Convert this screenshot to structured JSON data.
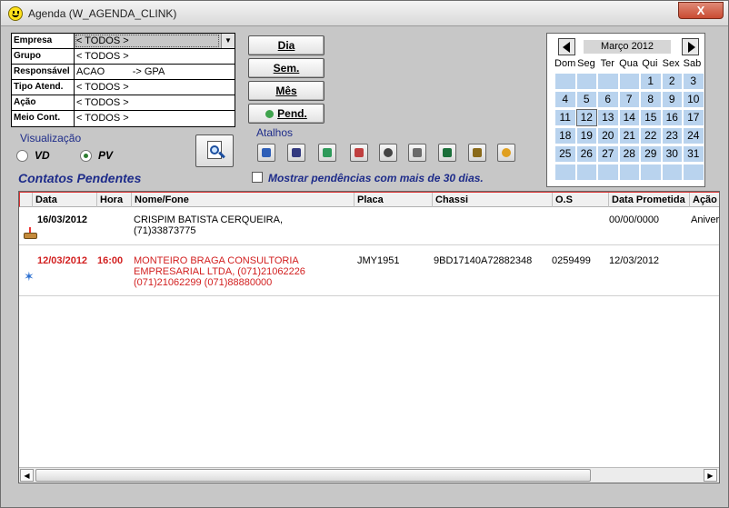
{
  "window": {
    "title": "Agenda (W_AGENDA_CLINK)",
    "close_label": "X"
  },
  "filters": [
    {
      "label": "Empresa",
      "value": "< TODOS >"
    },
    {
      "label": "Grupo",
      "value": "< TODOS >"
    },
    {
      "label": "Responsável",
      "value": "ACAO          -> GPA"
    },
    {
      "label": "Tipo Atend.",
      "value": "< TODOS >"
    },
    {
      "label": "Ação",
      "value": "< TODOS >"
    },
    {
      "label": "Meio Cont.",
      "value": "< TODOS >"
    }
  ],
  "view_buttons": {
    "dia": "Dia",
    "sem": "Sem.",
    "mes": "Mês",
    "pend": "Pend."
  },
  "visualizacao": {
    "label": "Visualização",
    "options": [
      "VD",
      "PV"
    ],
    "selected": "PV"
  },
  "atalhos": {
    "label": "Atalhos",
    "icons": [
      "car-icon",
      "runner-icon",
      "globe-icon",
      "card-icon",
      "wheel-icon",
      "checklist-icon",
      "spreadsheet-icon",
      "chip-icon",
      "coins-icon"
    ]
  },
  "section_title": "Contatos Pendentes",
  "pendencias_check": {
    "label": "Mostrar pendências com mais de 30 dias.",
    "checked": false
  },
  "calendar": {
    "month_label": "Março 2012",
    "weekdays": [
      "Dom",
      "Seg",
      "Ter",
      "Qua",
      "Qui",
      "Sex",
      "Sab"
    ],
    "cells": [
      "",
      "",
      "",
      "",
      "1",
      "2",
      "3",
      "4",
      "5",
      "6",
      "7",
      "8",
      "9",
      "10",
      "11",
      "12",
      "13",
      "14",
      "15",
      "16",
      "17",
      "18",
      "19",
      "20",
      "21",
      "22",
      "23",
      "24",
      "25",
      "26",
      "27",
      "28",
      "29",
      "30",
      "31",
      "",
      "",
      "",
      "",
      "",
      "",
      ""
    ],
    "selected_day": "12"
  },
  "grid": {
    "columns": [
      "Data",
      "Hora",
      "Nome/Fone",
      "Placa",
      "Chassi",
      "O.S",
      "Data Prometida",
      "Ação C"
    ],
    "rows": [
      {
        "icon": "cake-icon",
        "highlight": false,
        "data": "16/03/2012",
        "hora": "",
        "nome_lines": [
          "CRISPIM BATISTA CERQUEIRA,",
          "(71)33873775"
        ],
        "placa": "",
        "chassi": "",
        "os": "",
        "data_prometida": "00/00/0000",
        "acao": "Aniver"
      },
      {
        "icon": "fireworks-icon",
        "highlight": true,
        "data": "12/03/2012",
        "hora": "16:00",
        "nome_lines": [
          "MONTEIRO BRAGA CONSULTORIA",
          "EMPRESARIAL LTDA, (071)21062226",
          "(071)21062299 (071)88880000"
        ],
        "placa": "JMY1951",
        "chassi": "9BD17140A72882348",
        "os": "0259499",
        "data_prometida": "12/03/2012",
        "acao": ""
      }
    ]
  },
  "colors": {
    "accent_blue": "#1e2c8a",
    "alert_red": "#d21f1f",
    "calendar_cell": "#b9d3ee"
  }
}
